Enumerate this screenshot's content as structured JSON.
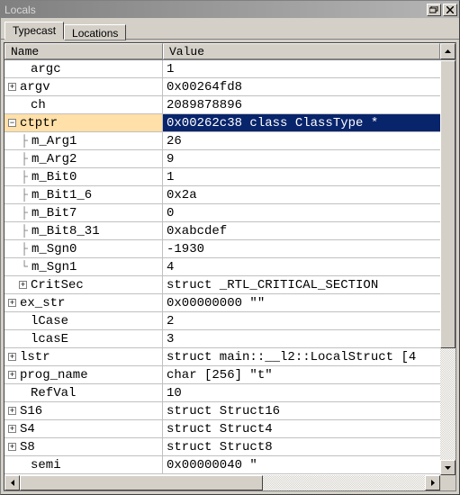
{
  "title": "Locals",
  "tabs": [
    {
      "label": "Typecast",
      "active": true
    },
    {
      "label": "Locations",
      "active": false
    }
  ],
  "columns": {
    "name": "Name",
    "value": "Value"
  },
  "rows": [
    {
      "indent": 1,
      "toggle": "",
      "tree": "",
      "name": "argc",
      "value": "1",
      "selected": false
    },
    {
      "indent": 0,
      "toggle": "plus",
      "tree": "",
      "name": "argv",
      "value": "0x00264fd8",
      "selected": false
    },
    {
      "indent": 1,
      "toggle": "",
      "tree": "",
      "name": "ch",
      "value": "2089878896",
      "selected": false
    },
    {
      "indent": 0,
      "toggle": "minus",
      "tree": "",
      "name": "ctptr",
      "value": "0x00262c38 class ClassType *",
      "selected": true
    },
    {
      "indent": 1,
      "toggle": "",
      "tree": "├",
      "name": "m_Arg1",
      "value": "26",
      "selected": false
    },
    {
      "indent": 1,
      "toggle": "",
      "tree": "├",
      "name": "m_Arg2",
      "value": "9",
      "selected": false
    },
    {
      "indent": 1,
      "toggle": "",
      "tree": "├",
      "name": "m_Bit0",
      "value": "1",
      "selected": false
    },
    {
      "indent": 1,
      "toggle": "",
      "tree": "├",
      "name": "m_Bit1_6",
      "value": "0x2a",
      "selected": false
    },
    {
      "indent": 1,
      "toggle": "",
      "tree": "├",
      "name": "m_Bit7",
      "value": "0",
      "selected": false
    },
    {
      "indent": 1,
      "toggle": "",
      "tree": "├",
      "name": "m_Bit8_31",
      "value": "0xabcdef",
      "selected": false
    },
    {
      "indent": 1,
      "toggle": "",
      "tree": "├",
      "name": "m_Sgn0",
      "value": "-1930",
      "selected": false
    },
    {
      "indent": 1,
      "toggle": "",
      "tree": "└",
      "name": "m_Sgn1",
      "value": "4",
      "selected": false
    },
    {
      "indent": 1,
      "toggle": "plus",
      "tree": "",
      "name": "CritSec",
      "value": "struct _RTL_CRITICAL_SECTION",
      "selected": false
    },
    {
      "indent": 0,
      "toggle": "plus",
      "tree": "",
      "name": "ex_str",
      "value": "0x00000000 \"\"",
      "selected": false
    },
    {
      "indent": 1,
      "toggle": "",
      "tree": "",
      "name": "lCase",
      "value": "2",
      "selected": false
    },
    {
      "indent": 1,
      "toggle": "",
      "tree": "",
      "name": "lcasE",
      "value": "3",
      "selected": false
    },
    {
      "indent": 0,
      "toggle": "plus",
      "tree": "",
      "name": "lstr",
      "value": "struct main::__l2::LocalStruct [4",
      "selected": false
    },
    {
      "indent": 0,
      "toggle": "plus",
      "tree": "",
      "name": "prog_name",
      "value": "char [256] \"t\"",
      "selected": false
    },
    {
      "indent": 1,
      "toggle": "",
      "tree": "",
      "name": "RefVal",
      "value": "10",
      "selected": false
    },
    {
      "indent": 0,
      "toggle": "plus",
      "tree": "",
      "name": "S16",
      "value": "struct Struct16",
      "selected": false
    },
    {
      "indent": 0,
      "toggle": "plus",
      "tree": "",
      "name": "S4",
      "value": "struct Struct4",
      "selected": false
    },
    {
      "indent": 0,
      "toggle": "plus",
      "tree": "",
      "name": "S8",
      "value": "struct Struct8",
      "selected": false
    },
    {
      "indent": 1,
      "toggle": "",
      "tree": "",
      "name": "semi",
      "value": "0x00000040 \"",
      "selected": false
    }
  ]
}
